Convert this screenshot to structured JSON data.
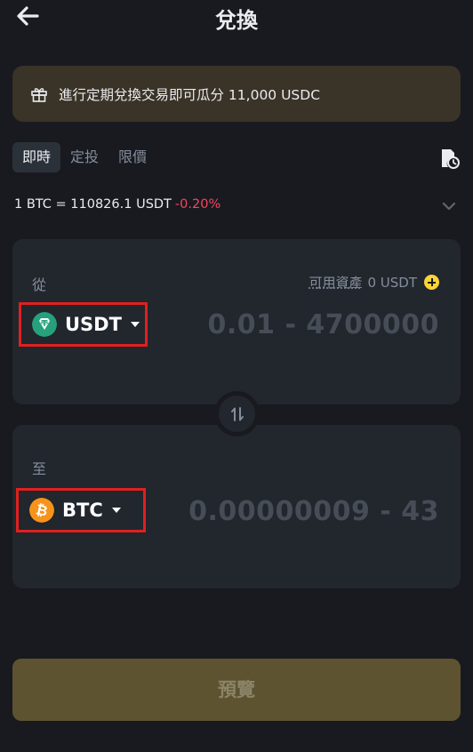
{
  "header": {
    "title": "兌換"
  },
  "promo": {
    "text": "進行定期兌換交易即可瓜分 11,000 USDC"
  },
  "tabs": [
    {
      "label": "即時",
      "active": true
    },
    {
      "label": "定投",
      "active": false
    },
    {
      "label": "限價",
      "active": false
    }
  ],
  "rate": {
    "text": "1 BTC = 110826.1 USDT",
    "change": "-0.20%"
  },
  "from": {
    "label": "從",
    "available_label": "可用資產",
    "available_value": "0 USDT",
    "coin": "USDT",
    "amount_placeholder": "0.01 - 4700000"
  },
  "to": {
    "label": "至",
    "coin": "BTC",
    "amount_placeholder": "0.00000009 - 43"
  },
  "preview_button": "預覽",
  "colors": {
    "background": "#181a20",
    "card": "#22262d",
    "accent": "#fcd535",
    "negative": "#f6465d",
    "usdt": "#26a17b",
    "btc": "#f7931a",
    "highlight_box": "#e0201f"
  }
}
